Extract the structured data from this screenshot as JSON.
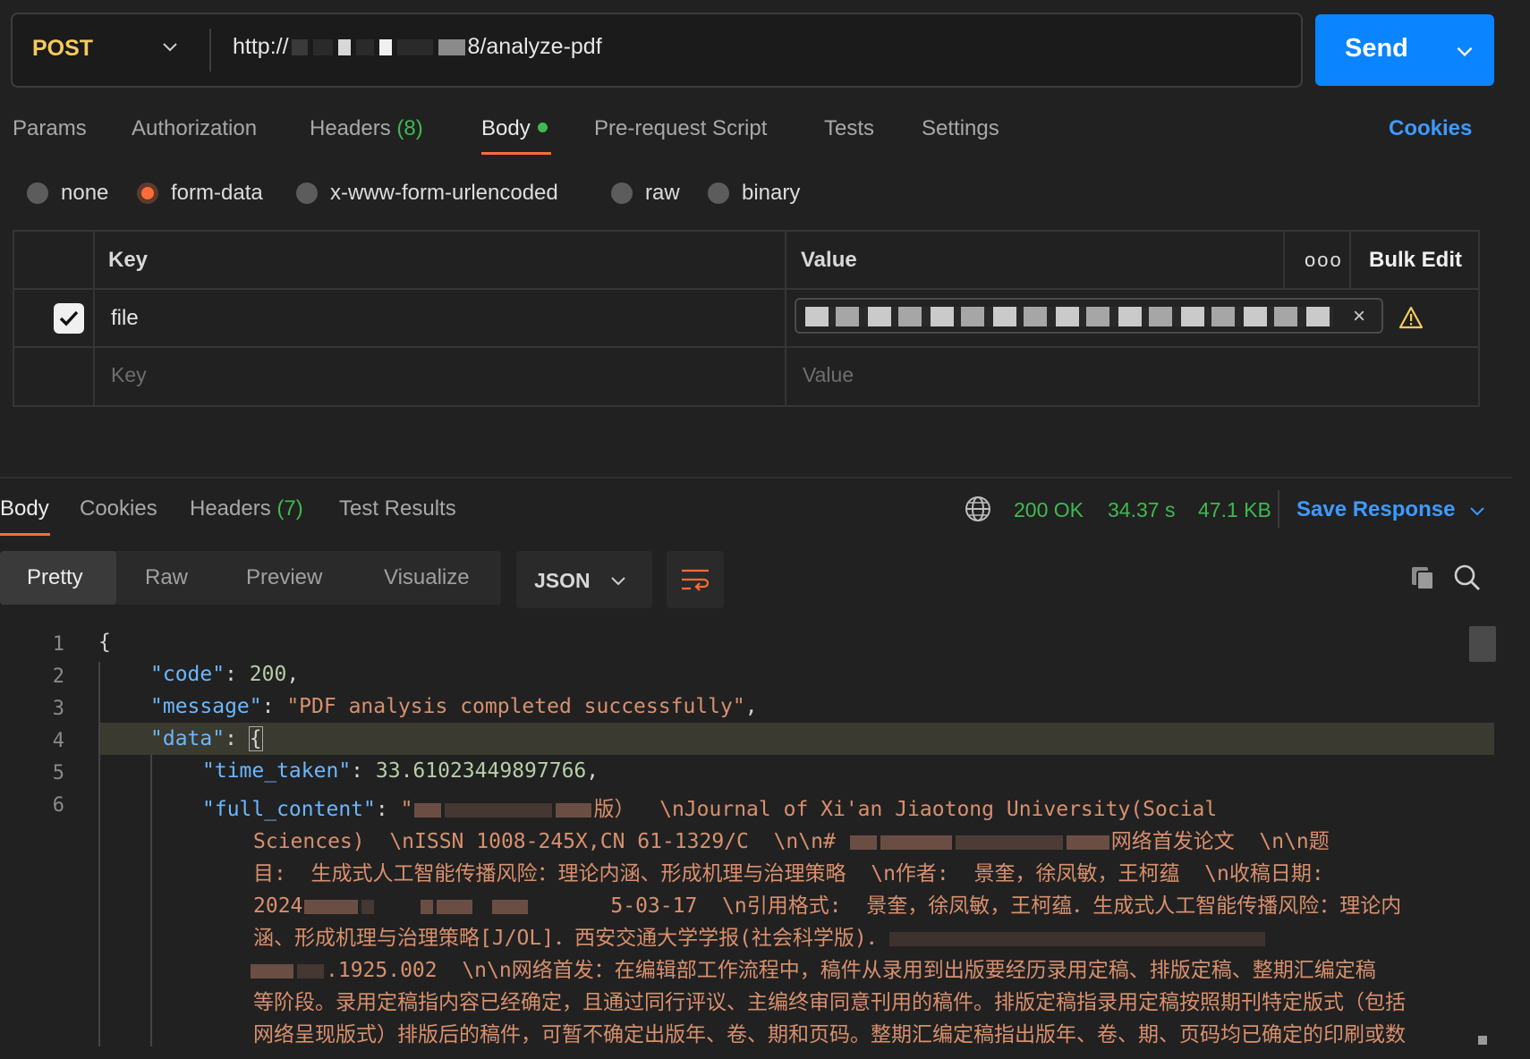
{
  "request": {
    "method": "POST",
    "url_suffix": "8/analyze-pdf",
    "url_prefix": "http://",
    "send_label": "Send"
  },
  "tabs": {
    "params": "Params",
    "authorization": "Authorization",
    "headers": "Headers",
    "headers_count": "(8)",
    "body": "Body",
    "prerequest": "Pre-request Script",
    "tests": "Tests",
    "settings": "Settings",
    "cookies": "Cookies"
  },
  "body_types": {
    "none": "none",
    "form_data": "form-data",
    "urlencoded": "x-www-form-urlencoded",
    "raw": "raw",
    "binary": "binary",
    "selected": "form-data"
  },
  "form_table": {
    "key_header": "Key",
    "value_header": "Value",
    "more": "ooo",
    "bulk_edit": "Bulk Edit",
    "rows": [
      {
        "key": "file",
        "checked": true
      }
    ],
    "key_placeholder": "Key",
    "value_placeholder": "Value"
  },
  "response": {
    "tabs": {
      "body": "Body",
      "cookies": "Cookies",
      "headers": "Headers",
      "headers_count": "(7)",
      "test_results": "Test Results"
    },
    "status": "200 OK",
    "time": "34.37 s",
    "size": "47.1 KB",
    "save_response": "Save Response",
    "views": {
      "pretty": "Pretty",
      "raw": "Raw",
      "preview": "Preview",
      "visualize": "Visualize"
    },
    "format": "JSON"
  },
  "code": {
    "line_numbers": [
      "1",
      "2",
      "3",
      "4",
      "5",
      "6"
    ],
    "l1": "{",
    "l2_key": "\"code\"",
    "l2_val": "200",
    "l3_key": "\"message\"",
    "l3_val": "\"PDF analysis completed successfully\"",
    "l4_key": "\"data\"",
    "l4_val": "{",
    "l5_key": "\"time_taken\"",
    "l5_val": "33.61023449897766",
    "l6_key": "\"full_content\"",
    "l6_a": "版）  \\nJournal of Xi'an Jiaotong University(Social",
    "l6_b_start": "Sciences)  \\nISSN 1008-245X,CN 61-1329/C  \\n\\n#",
    "l6_b_end": "网络首发论文  \\n\\n题",
    "l6_c": "目:  生成式人工智能传播风险：理论内涵、形成机理与治理策略  \\n作者:  景奎，徐凤敏，王柯蕴  \\n收稿日期:",
    "l6_d_start": "2024",
    "l6_d_end": "5-03-17  \\n引用格式:  景奎，徐凤敏，王柯蕴．生成式人工智能传播风险：理论内",
    "l6_e": "涵、形成机理与治理策略[J/OL]．西安交通大学学报(社会科学版)．",
    "l6_f_end": ".1925.002  \\n\\n网络首发：在编辑部工作流程中，稿件从录用到出版要经历录用定稿、排版定稿、整期汇编定稿",
    "l6_g": "等阶段。录用定稿指内容已经确定，且通过同行评议、主编终审同意刊用的稿件。排版定稿指录用定稿按照期刊特定版式（包括",
    "l6_h": "网络呈现版式）排版后的稿件，可暂不确定出版年、卷、期和页码。整期汇编定稿指出版年、卷、期、页码均已确定的印刷或数"
  }
}
